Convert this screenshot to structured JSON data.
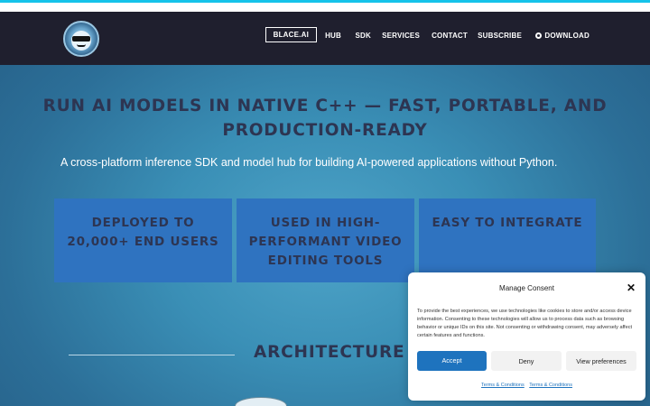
{
  "header": {
    "logo_icon": "sunglasses-globe-logo",
    "nav": [
      {
        "label": "BLACE.AI",
        "active": true
      },
      {
        "label": "HUB"
      },
      {
        "label": "SDK"
      },
      {
        "label": "SERVICES"
      },
      {
        "label": "CONTACT"
      },
      {
        "label": "SUBSCRIBE"
      },
      {
        "label": "DOWNLOAD",
        "icon": "github-icon"
      }
    ]
  },
  "hero": {
    "title": "RUN AI MODELS IN NATIVE C++ — FAST, PORTABLE, AND PRODUCTION-READY",
    "subtitle": "A cross-platform inference SDK and model hub for building AI-powered applications without Python."
  },
  "features": [
    {
      "label": "DEPLOYED TO 20,000+ END USERS"
    },
    {
      "label": "USED IN HIGH-PERFORMANT VIDEO EDITING TOOLS"
    },
    {
      "label": "EASY TO INTEGRATE"
    }
  ],
  "architecture": {
    "title": "ARCHITECTURE"
  },
  "consent": {
    "title": "Manage Consent",
    "close_icon": "close-icon",
    "body": "To provide the best experiences, we use technologies like cookies to store and/or access device information. Consenting to these technologies will allow us to process data such as browsing behavior or unique IDs on this site. Not consenting or withdrawing consent, may adversely affect certain features and functions.",
    "accept_label": "Accept",
    "deny_label": "Deny",
    "preferences_label": "View preferences",
    "links": [
      "Terms & Conditions",
      "Terms & Conditions"
    ]
  },
  "colors": {
    "accent_cyan": "#15c3ea",
    "header_bg": "#1f1f2e",
    "card_bg": "#2f73c0",
    "heading_text": "#2d3552",
    "accept_button": "#1e73be"
  }
}
